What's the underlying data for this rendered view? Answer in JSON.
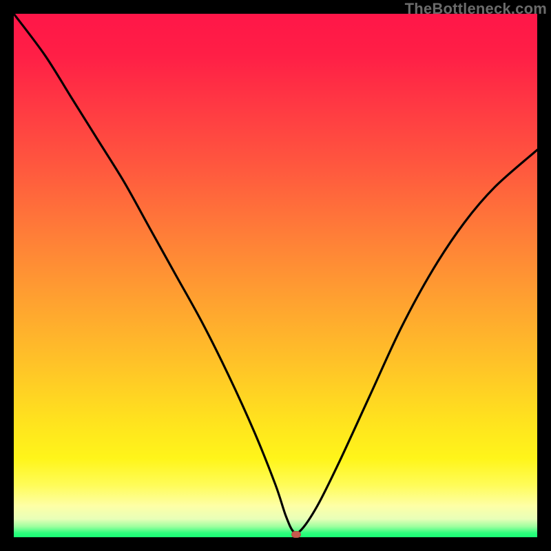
{
  "watermark": "TheBottleneck.com",
  "colors": {
    "curve": "#000000",
    "marker": "#c65a4e",
    "frame": "#000000"
  },
  "chart_data": {
    "type": "line",
    "title": "",
    "xlabel": "",
    "ylabel": "",
    "xlim": [
      0,
      100
    ],
    "ylim": [
      0,
      100
    ],
    "grid": false,
    "series": [
      {
        "name": "bottleneck-curve",
        "x": [
          0,
          6,
          11,
          16,
          21,
          26,
          31,
          36,
          41,
          46,
          50,
          52,
          53.5,
          55,
          58,
          62,
          68,
          74,
          80,
          86,
          92,
          100
        ],
        "y": [
          100,
          92,
          84,
          76,
          68,
          59,
          50,
          41,
          31,
          20,
          10,
          4,
          1,
          1.5,
          6,
          14,
          27,
          40,
          51,
          60,
          67,
          74
        ]
      }
    ],
    "annotations": [
      {
        "name": "optimal-point",
        "x": 54,
        "y": 0.5
      }
    ]
  }
}
